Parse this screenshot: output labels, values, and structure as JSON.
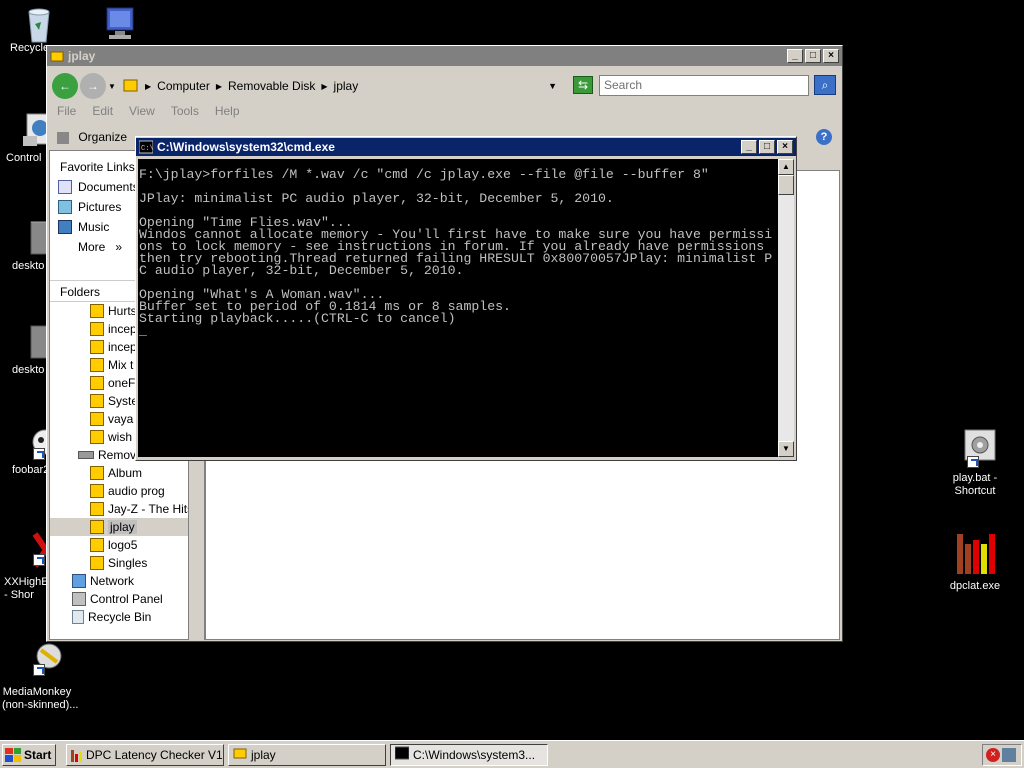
{
  "desktop": {
    "icons": [
      {
        "name": "recycle-bin",
        "label": "Recycle"
      },
      {
        "name": "computer",
        "label": ""
      },
      {
        "name": "control-panel",
        "label": "Control"
      },
      {
        "name": "desktop-ini-1",
        "label": "deskto"
      },
      {
        "name": "desktop-ini-2",
        "label": "deskto"
      },
      {
        "name": "foobar",
        "label": "foobar2"
      },
      {
        "name": "xxhighend",
        "label": "XXHighE\n- Shor"
      },
      {
        "name": "mediamonkey",
        "label": "MediaMonkey\n(non-skinned)..."
      },
      {
        "name": "play-bat",
        "label": "play.bat -\nShortcut"
      },
      {
        "name": "dpclat",
        "label": "dpclat.exe"
      }
    ]
  },
  "explorer": {
    "title": "jplay",
    "breadcrumb": [
      "Computer",
      "Removable Disk",
      "jplay"
    ],
    "search_placeholder": "Search",
    "menu": [
      "File",
      "Edit",
      "View",
      "Tools",
      "Help"
    ],
    "organize_label": "Organize",
    "favorite_links_label": "Favorite Links",
    "favorites": [
      "Documents",
      "Pictures",
      "Music",
      "More"
    ],
    "more_suffix": "»",
    "folders_label": "Folders",
    "tree": [
      {
        "label": "Hurts",
        "indent": 2
      },
      {
        "label": "incep",
        "indent": 2
      },
      {
        "label": "incep",
        "indent": 2
      },
      {
        "label": "Mix t",
        "indent": 2
      },
      {
        "label": "oneF",
        "indent": 2
      },
      {
        "label": "Syste",
        "indent": 2
      },
      {
        "label": "vaya",
        "indent": 2
      },
      {
        "label": "wish",
        "indent": 2
      },
      {
        "label": "Remov",
        "indent": 1,
        "drive": true
      },
      {
        "label": "Album",
        "indent": 2
      },
      {
        "label": "audio prog",
        "indent": 2
      },
      {
        "label": "Jay-Z - The Hits",
        "indent": 2
      },
      {
        "label": "jplay",
        "indent": 2,
        "selected": true
      },
      {
        "label": "logo5",
        "indent": 2
      },
      {
        "label": "Singles",
        "indent": 2
      },
      {
        "label": "Network",
        "indent": 0,
        "icon": "network"
      },
      {
        "label": "Control Panel",
        "indent": 0,
        "icon": "control"
      },
      {
        "label": "Recycle Bin",
        "indent": 0,
        "icon": "recycle"
      }
    ]
  },
  "cmd": {
    "title": "C:\\Windows\\system32\\cmd.exe",
    "lines": [
      "F:\\jplay>forfiles /M *.wav /c \"cmd /c jplay.exe --file @file --buffer 8\"",
      "",
      "JPlay: minimalist PC audio player, 32-bit, December 5, 2010.",
      "",
      "Opening \"Time Flies.wav\"...",
      "Windos cannot allocate memory - You'll first have to make sure you have permissi",
      "ons to lock memory - see instructions in forum. If you already have permissions",
      "then try rebooting.Thread returned failing HRESULT 0x80070057JPlay: minimalist P",
      "C audio player, 32-bit, December 5, 2010.",
      "",
      "Opening \"What's A Woman.wav\"...",
      "Buffer set to period of 0.1814 ms or 8 samples.",
      "Starting playback.....(CTRL-C to cancel)",
      "_"
    ]
  },
  "taskbar": {
    "start_label": "Start",
    "buttons": [
      {
        "label": "DPC Latency Checker V1...",
        "icon": "dpc-icon"
      },
      {
        "label": "jplay",
        "icon": "folder-icon"
      },
      {
        "label": "C:\\Windows\\system3...",
        "icon": "cmd-icon",
        "pressed": true
      }
    ]
  },
  "colors": {
    "title_active": "#0a246a",
    "title_inactive": "#808080",
    "chrome": "#d4d0c8",
    "folder": "#ffcc00"
  }
}
